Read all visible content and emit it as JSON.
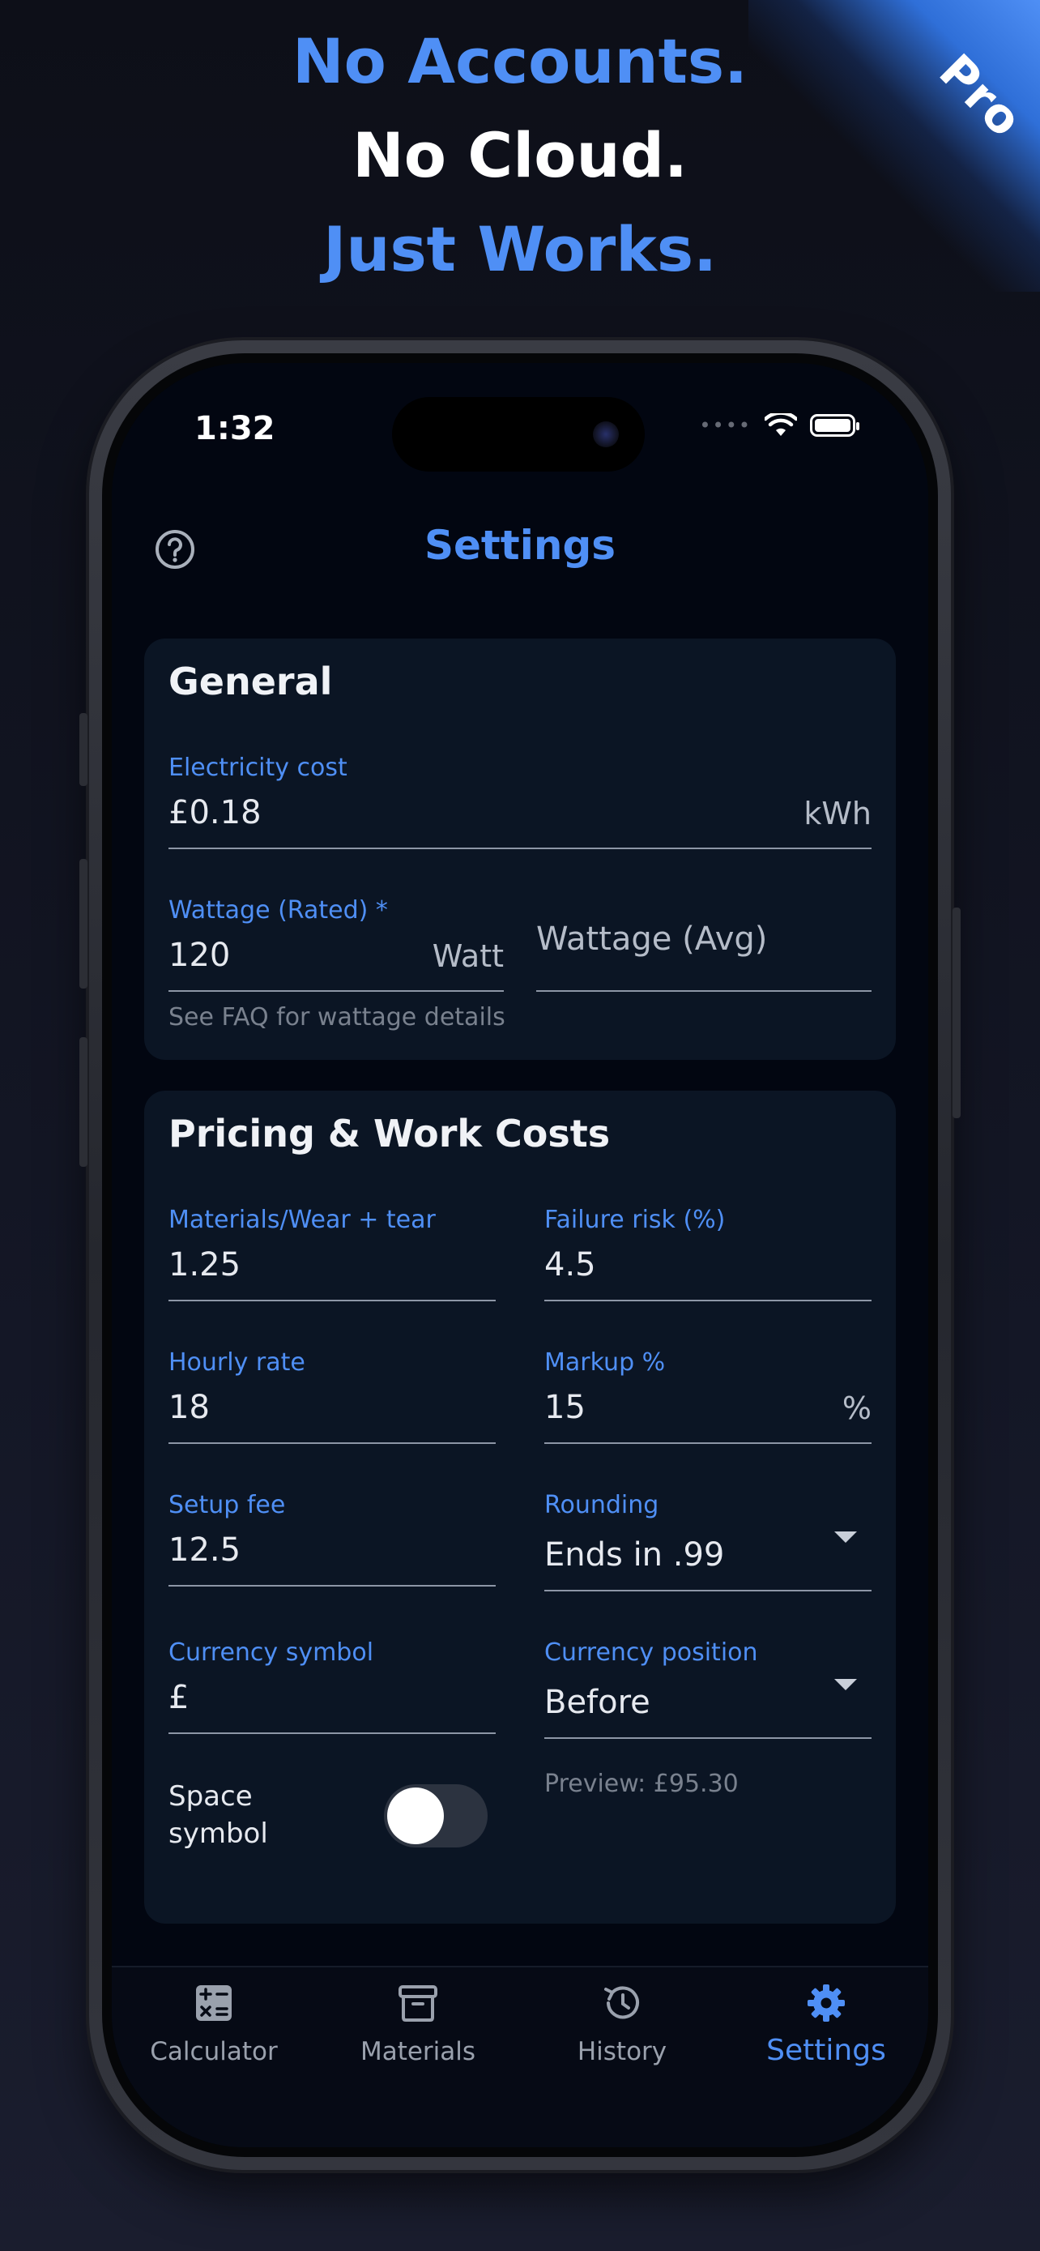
{
  "promo": {
    "line1": "No Accounts.",
    "line2": "No Cloud.",
    "line3": "Just Works.",
    "badge": "Pro"
  },
  "status_bar": {
    "time": "1:32"
  },
  "header": {
    "title": "Settings",
    "help_icon": "help-circle-icon"
  },
  "general": {
    "title": "General",
    "electricity": {
      "label": "Electricity cost",
      "value": "£0.18",
      "suffix": "kWh"
    },
    "wattage_rated": {
      "label": "Wattage (Rated) *",
      "value": "120",
      "suffix": "Watt"
    },
    "wattage_avg": {
      "placeholder": "Wattage (Avg)"
    },
    "helper": "See FAQ for wattage details"
  },
  "pricing": {
    "title": "Pricing & Work Costs",
    "materials": {
      "label": "Materials/Wear + tear",
      "value": "1.25"
    },
    "failure_risk": {
      "label": "Failure risk (%)",
      "value": "4.5"
    },
    "hourly_rate": {
      "label": "Hourly rate",
      "value": "18"
    },
    "markup": {
      "label": "Markup %",
      "value": "15",
      "suffix": "%"
    },
    "setup_fee": {
      "label": "Setup fee",
      "value": "12.5"
    },
    "rounding": {
      "label": "Rounding",
      "value": "Ends in .99"
    },
    "currency_symbol": {
      "label": "Currency symbol",
      "value": "£"
    },
    "currency_position": {
      "label": "Currency position",
      "value": "Before"
    },
    "preview": "Preview: £95.30",
    "space_symbol": {
      "label_line1": "Space",
      "label_line2": "symbol",
      "on": false
    }
  },
  "tabs": [
    {
      "label": "Calculator",
      "icon": "calculator-icon",
      "active": false
    },
    {
      "label": "Materials",
      "icon": "archive-box-icon",
      "active": false
    },
    {
      "label": "History",
      "icon": "history-icon",
      "active": false
    },
    {
      "label": "Settings",
      "icon": "gear-icon",
      "active": true
    }
  ],
  "colors": {
    "accent": "#4f8ff5",
    "background": "#020611",
    "card": "#0b1524"
  }
}
